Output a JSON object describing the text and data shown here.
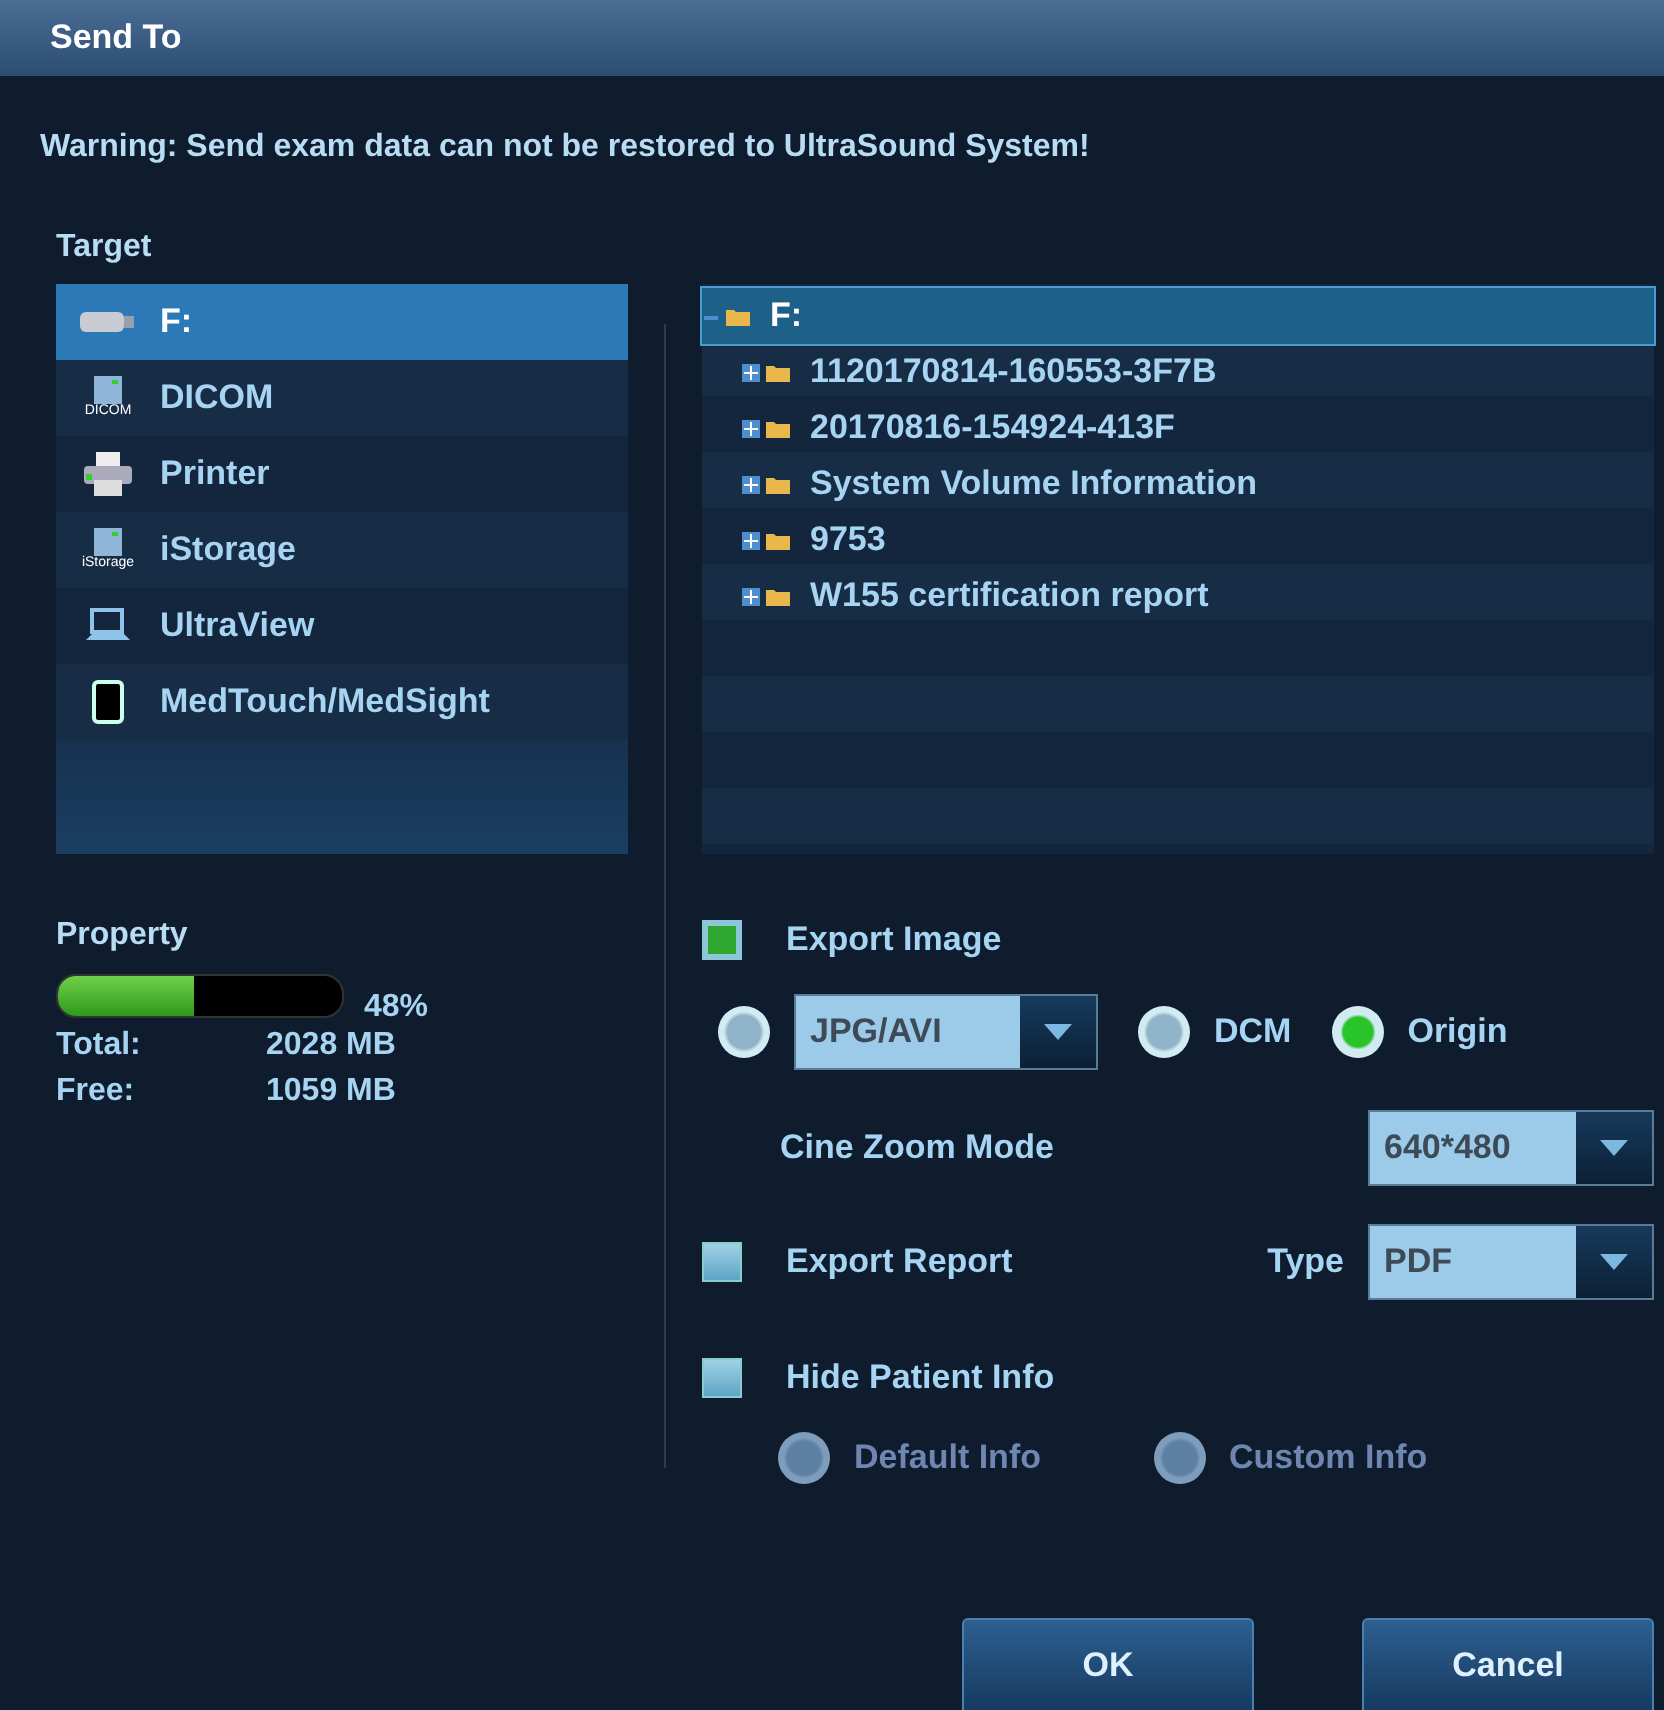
{
  "window": {
    "title": "Send To"
  },
  "warning": "Warning: Send exam data can not be restored to UltraSound System!",
  "target": {
    "label": "Target",
    "items": [
      {
        "label": "F:",
        "kind": "usb",
        "selected": true
      },
      {
        "label": "DICOM",
        "kind": "dicom",
        "icon_text": "DICOM",
        "selected": false
      },
      {
        "label": "Printer",
        "kind": "printer",
        "selected": false
      },
      {
        "label": "iStorage",
        "kind": "istorage",
        "icon_text": "iStorage",
        "selected": false
      },
      {
        "label": "UltraView",
        "kind": "laptop",
        "selected": false
      },
      {
        "label": "MedTouch/MedSight",
        "kind": "tablet",
        "selected": false
      }
    ]
  },
  "tree": {
    "label": "F:",
    "expanded": true,
    "selected": true,
    "children": [
      {
        "label": "1120170814-160553-3F7B",
        "expanded": false,
        "selected": false
      },
      {
        "label": "20170816-154924-413F",
        "expanded": false,
        "selected": false
      },
      {
        "label": "System Volume Information",
        "expanded": false,
        "selected": false
      },
      {
        "label": "9753",
        "expanded": false,
        "selected": false
      },
      {
        "label": "W155 certification report",
        "expanded": false,
        "selected": false
      }
    ]
  },
  "property": {
    "label": "Property",
    "level": 0.48,
    "percent": "48%",
    "rows": [
      {
        "label": "Total:",
        "value": "2028 MB"
      },
      {
        "label": "Free:",
        "value": "1059 MB"
      }
    ]
  },
  "export_image": {
    "label": "Export Image",
    "checked": true,
    "formats": [
      {
        "kind": "dropdown",
        "value": "JPG/AVI",
        "selected": false
      },
      {
        "kind": "plain",
        "label": "DCM",
        "selected": false
      },
      {
        "kind": "plain",
        "label": "Origin",
        "selected": true
      }
    ]
  },
  "cine_zoom": {
    "label": "Cine Zoom Mode",
    "value": "640*480"
  },
  "export_report": {
    "label": "Export Report",
    "checked": false,
    "type_label": "Type",
    "type_value": "PDF"
  },
  "hide_patient": {
    "label": "Hide Patient Info",
    "checked": false,
    "options": [
      {
        "label": "Default Info",
        "selected": false,
        "disabled": true
      },
      {
        "label": "Custom Info",
        "selected": false,
        "disabled": true
      }
    ]
  },
  "buttons": [
    {
      "label": "OK"
    },
    {
      "label": "Cancel"
    }
  ]
}
